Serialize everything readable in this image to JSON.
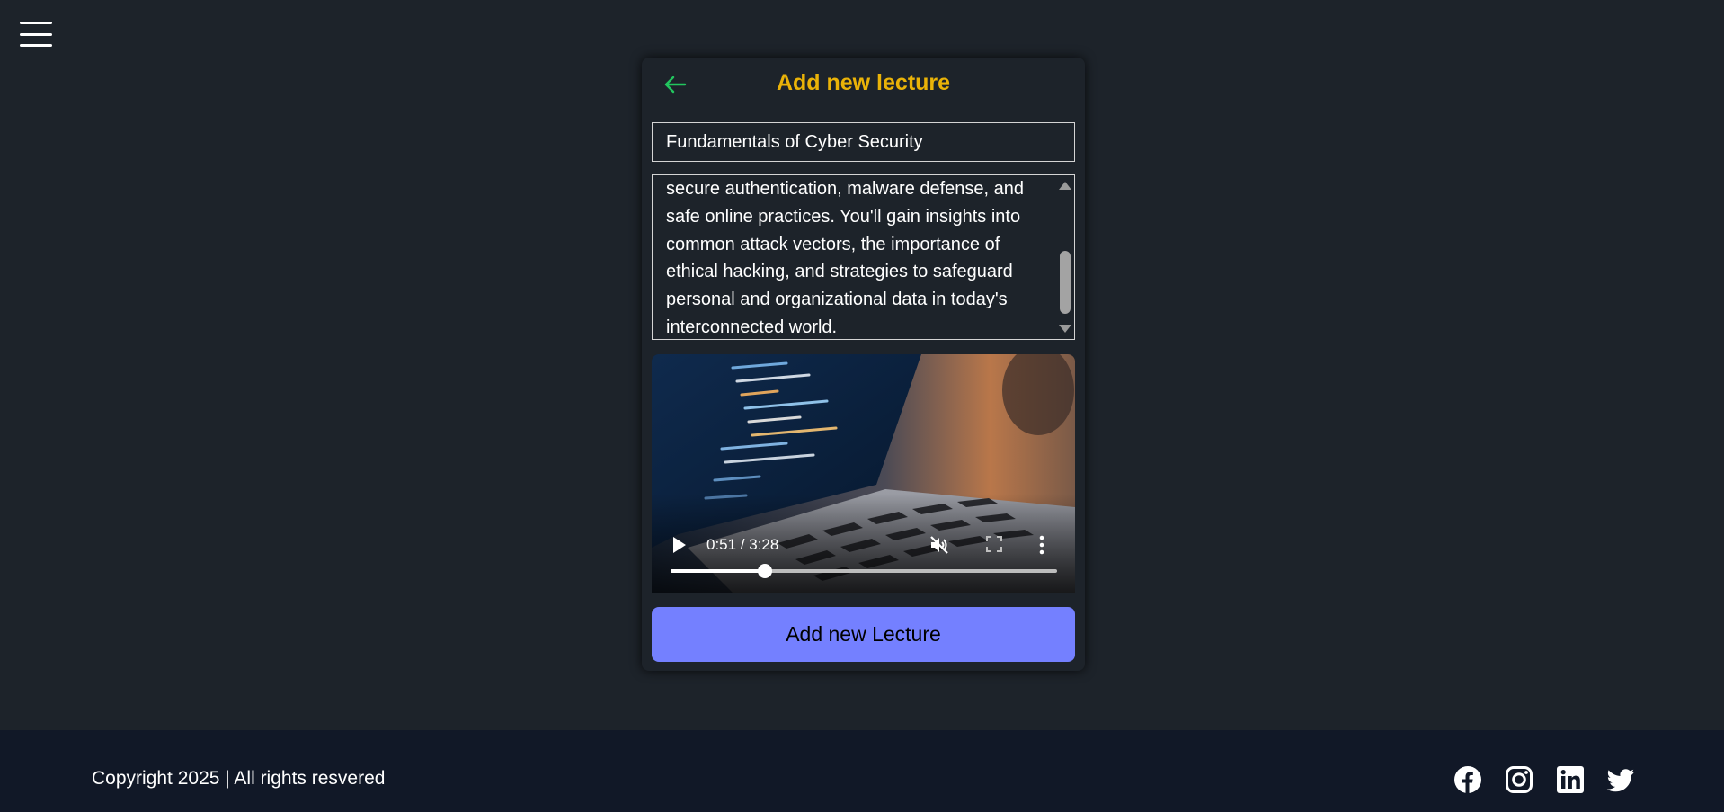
{
  "nav": {
    "menu_icon": "hamburger-menu-icon"
  },
  "card": {
    "title": "Add new lecture",
    "back_icon": "arrow-left-icon",
    "accent_color": "#eab308",
    "back_color": "#22c55e"
  },
  "form": {
    "title_value": "Fundamentals of Cyber Security",
    "description_visible_lines": [
      "secure authentication, malware defense, and",
      "safe online practices. You'll gain insights into",
      "common attack vectors, the importance of",
      "ethical hacking, and strategies to safeguard",
      "personal and organizational data in today's",
      "interconnected world."
    ],
    "submit_label": "Add new Lecture",
    "submit_color": "#7480ff"
  },
  "video": {
    "time_display": "0:51 / 3:28",
    "progress_fraction": 0.245,
    "muted": true,
    "icons": [
      "play-icon",
      "muted-speaker-icon",
      "fullscreen-icon",
      "more-vertical-icon"
    ]
  },
  "footer": {
    "copyright": "Copyright 2025 | All rights resvered",
    "social_icons": [
      "facebook-icon",
      "instagram-icon",
      "linkedin-icon",
      "twitter-icon"
    ]
  }
}
